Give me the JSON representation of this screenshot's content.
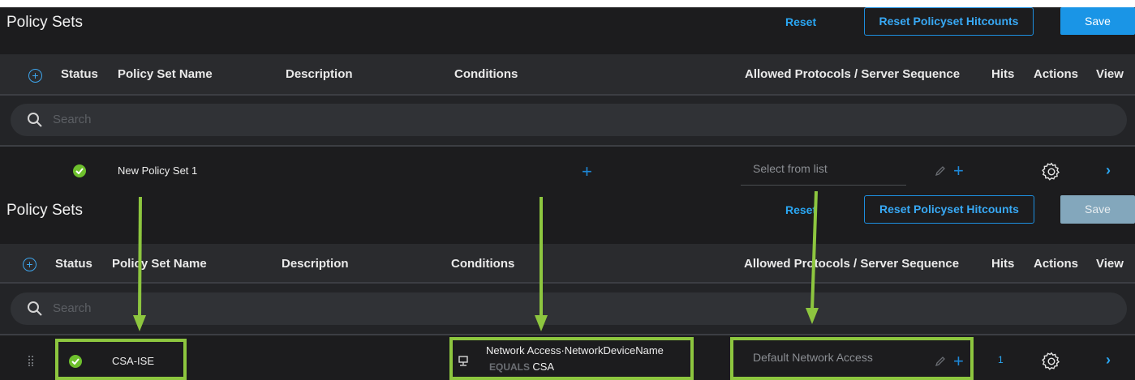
{
  "top": {
    "title": "Policy Sets",
    "reset_label": "Reset",
    "reset_hitcounts_label": "Reset Policyset Hitcounts",
    "save_label": "Save",
    "columns": {
      "status": "Status",
      "name": "Policy Set Name",
      "description": "Description",
      "conditions": "Conditions",
      "protocols": "Allowed Protocols / Server Sequence",
      "hits": "Hits",
      "actions": "Actions",
      "view": "View"
    },
    "search_placeholder": "Search",
    "row": {
      "name": "New Policy Set 1",
      "protocol_placeholder": "Select from list"
    }
  },
  "bottom": {
    "title": "Policy Sets",
    "reset_label": "Reset",
    "reset_hitcounts_label": "Reset Policyset Hitcounts",
    "save_label": "Save",
    "columns": {
      "status": "Status",
      "name": "Policy Set Name",
      "description": "Description",
      "conditions": "Conditions",
      "protocols": "Allowed Protocols / Server Sequence",
      "hits": "Hits",
      "actions": "Actions",
      "view": "View"
    },
    "search_placeholder": "Search",
    "row": {
      "name": "CSA-ISE",
      "condition_attribute": "Network Access·NetworkDeviceName",
      "condition_operator": "EQUALS",
      "condition_value": "CSA",
      "protocol": "Default Network Access",
      "hits": "1"
    }
  },
  "colors": {
    "accent": "#2aa6f2",
    "status_ok": "#6ec02d",
    "annotation": "#8dc63f"
  }
}
